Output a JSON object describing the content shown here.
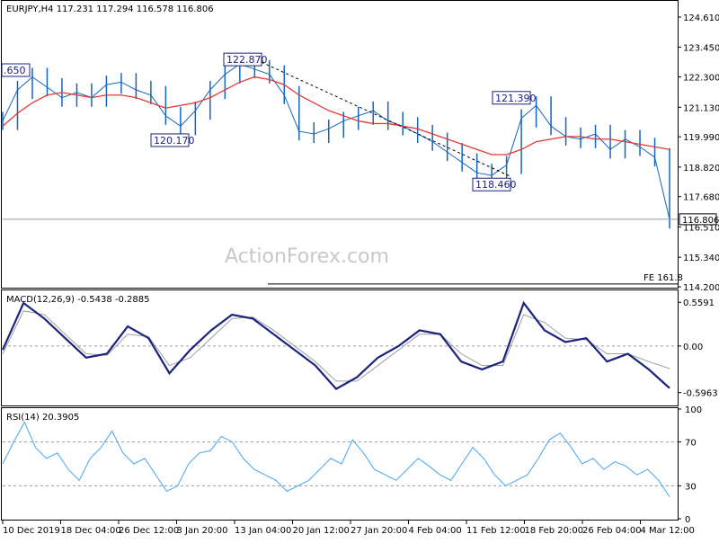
{
  "header": {
    "symbol_info": "EURJPY,H4  117.231 117.294 116.578 116.806"
  },
  "watermark": "ActionForex.com",
  "colors": {
    "candles": "#1565c0",
    "moving_average": "#e53935",
    "macd_line": "#1a237e",
    "macd_signal": "#9e9e9e",
    "rsi_line": "#42a5f5",
    "callouts": "#1a237e"
  },
  "chart_data": [
    {
      "type": "line",
      "panel": "price",
      "title": "EURJPY,H4  117.231 117.294 116.578 116.806",
      "x": [
        "10 Dec 2019",
        "18 Dec 04:00",
        "26 Dec 12:00",
        "3 Jan 20:00",
        "13 Jan 04:00",
        "20 Jan 12:00",
        "27 Jan 20:00",
        "4 Feb 04:00",
        "11 Feb 12:00",
        "18 Feb 20:00",
        "26 Feb 04:00",
        "4 Mar 12:00"
      ],
      "ylim": [
        114.2,
        125.2
      ],
      "y_ticks": [
        "124.610",
        "123.450",
        "122.300",
        "121.130",
        "119.990",
        "118.820",
        "117.680",
        "116.510",
        "115.340",
        "114.200"
      ],
      "series": [
        {
          "values": [
            120.6,
            121.8,
            122.3,
            121.9,
            121.5,
            121.7,
            121.5,
            122.0,
            122.1,
            121.8,
            121.6,
            120.8,
            120.4,
            121.0,
            121.8,
            122.4,
            122.8,
            122.6,
            122.4,
            121.6,
            120.2,
            120.1,
            120.3,
            120.6,
            120.8,
            121.0,
            120.6,
            120.4,
            120.1,
            119.8,
            119.4,
            119.0,
            118.6,
            118.5,
            118.9,
            120.7,
            121.2,
            120.4,
            120.0,
            119.9,
            120.1,
            119.5,
            119.9,
            119.6,
            119.2,
            116.8
          ]
        },
        {
          "name": "moving average",
          "values": [
            120.4,
            120.9,
            121.3,
            121.6,
            121.7,
            121.6,
            121.5,
            121.6,
            121.6,
            121.5,
            121.3,
            121.1,
            121.2,
            121.3,
            121.5,
            121.8,
            122.1,
            122.3,
            122.2,
            122.0,
            121.6,
            121.3,
            121.0,
            120.8,
            120.6,
            120.5,
            120.5,
            120.4,
            120.3,
            120.1,
            119.9,
            119.7,
            119.5,
            119.3,
            119.3,
            119.5,
            119.8,
            119.9,
            120.0,
            120.0,
            119.9,
            119.9,
            119.8,
            119.7,
            119.6,
            119.5
          ]
        }
      ],
      "annotations": [
        "122.870",
        "120.170",
        "121.390",
        "118.460"
      ],
      "current_price": "116.806",
      "partial_label": ".650",
      "fe_label": "FE 161.8",
      "fe_level": 114.31
    },
    {
      "type": "line",
      "panel": "macd",
      "title": "MACD(12,26,9) -0.5438 -0.2885",
      "ylim": [
        -0.75,
        0.7
      ],
      "y_ticks": [
        "0.5591",
        "0.00",
        "-0.5963"
      ],
      "series": [
        {
          "values": [
            -0.05,
            0.55,
            0.35,
            0.1,
            -0.15,
            -0.1,
            0.25,
            0.1,
            -0.35,
            -0.05,
            0.2,
            0.4,
            0.35,
            0.15,
            -0.05,
            -0.25,
            -0.55,
            -0.4,
            -0.15,
            0.0,
            0.2,
            0.15,
            -0.2,
            -0.3,
            -0.2,
            0.55,
            0.2,
            0.05,
            0.1,
            -0.2,
            -0.1,
            -0.3,
            -0.54
          ]
        },
        {
          "name": "signal",
          "values": [
            -0.1,
            0.45,
            0.4,
            0.15,
            -0.1,
            -0.12,
            0.15,
            0.12,
            -0.25,
            -0.15,
            0.1,
            0.35,
            0.37,
            0.2,
            0.0,
            -0.2,
            -0.45,
            -0.45,
            -0.25,
            -0.05,
            0.15,
            0.15,
            -0.1,
            -0.25,
            -0.25,
            0.4,
            0.3,
            0.1,
            0.08,
            -0.1,
            -0.1,
            -0.2,
            -0.29
          ]
        }
      ]
    },
    {
      "type": "line",
      "panel": "rsi",
      "title": "RSI(14) 20.3905",
      "ylim": [
        0,
        100
      ],
      "y_ticks": [
        "100",
        "70",
        "30",
        "0"
      ],
      "series": [
        {
          "values": [
            50,
            70,
            88,
            65,
            55,
            60,
            45,
            35,
            55,
            65,
            80,
            60,
            50,
            55,
            40,
            25,
            30,
            50,
            60,
            62,
            75,
            70,
            55,
            45,
            40,
            35,
            25,
            30,
            35,
            45,
            55,
            50,
            72,
            60,
            45,
            40,
            35,
            45,
            55,
            48,
            40,
            35,
            50,
            65,
            55,
            40,
            30,
            35,
            40,
            55,
            72,
            78,
            65,
            50,
            55,
            45,
            52,
            48,
            40,
            45,
            35,
            20
          ]
        }
      ]
    }
  ]
}
